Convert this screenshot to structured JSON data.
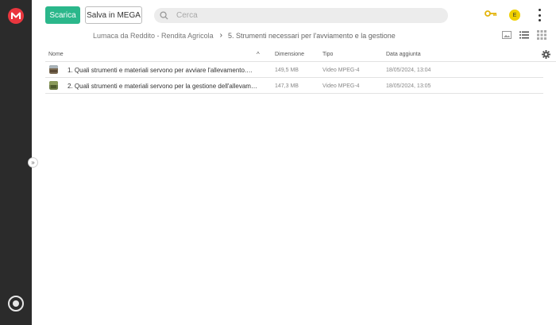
{
  "actions": {
    "download_label": "Scarica",
    "save_label": "Salva in MEGA"
  },
  "search": {
    "placeholder": "Cerca"
  },
  "user": {
    "avatar_initial": "E"
  },
  "breadcrumb": {
    "parent": "Lumaca da Reddito - Rendita Agricola",
    "separator": "›",
    "current": "5. Strumenti necessari per l'avviamento e la gestione"
  },
  "table": {
    "headers": {
      "name": "Nome",
      "size": "Dimensione",
      "type": "Tipo",
      "date": "Data aggiunta"
    },
    "sort_indicator": "^",
    "rows": [
      {
        "name": "1. Quali strumenti e materiali servono per avviare l'allevamento.…",
        "size": "149,5 MB",
        "type": "Video MPEG-4",
        "date": "18/05/2024, 13:04"
      },
      {
        "name": "2. Quali strumenti e materiali servono per la gestione dell'allevam…",
        "size": "147,3 MB",
        "type": "Video MPEG-4",
        "date": "18/05/2024, 13:05"
      }
    ]
  },
  "sidebar": {
    "expand_glyph": "»"
  },
  "colors": {
    "accent": "#2bb78b",
    "brand_red": "#e9363e",
    "rail": "#2b2b2b"
  },
  "icons": [
    "mega-logo-icon",
    "search-icon",
    "key-icon",
    "kebab-menu-icon",
    "thumbnail-view-icon",
    "list-view-icon",
    "grid-view-icon",
    "gear-icon",
    "video-thumbnail-icon",
    "rubbish-bin-icon"
  ]
}
